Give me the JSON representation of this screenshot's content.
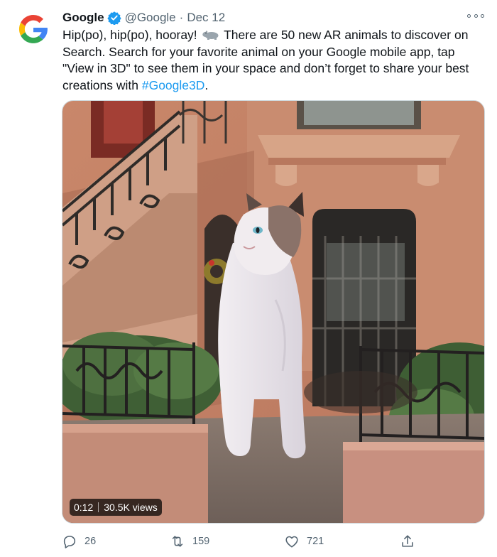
{
  "tweet": {
    "author_name": "Google",
    "handle": "@Google",
    "separator": "·",
    "date": "Dec 12",
    "text_lines": [
      {
        "before": "Hip(po), hip(po), hooray!",
        "after": "There are 50 new AR animals to discover on"
      },
      "Search. Search for your favorite animal on your Google mobile app, tap",
      "\"View in 3D\" to see them in your space and don’t forget to share your best"
    ],
    "last_line_prefix": "creations with ",
    "hashtag": "#Google3D",
    "last_line_suffix": ".",
    "emoji_icon": "hippo-emoji",
    "verified_icon": "verified-badge-icon"
  },
  "media": {
    "duration": "0:12",
    "views": "30.5K views",
    "description_icon": "video-thumbnail-cat"
  },
  "actions": {
    "reply_count": "26",
    "retweet_count": "159",
    "like_count": "721"
  },
  "colors": {
    "accent": "#1d9bf0",
    "secondary_text": "#536471",
    "primary_text": "#0f1419"
  }
}
